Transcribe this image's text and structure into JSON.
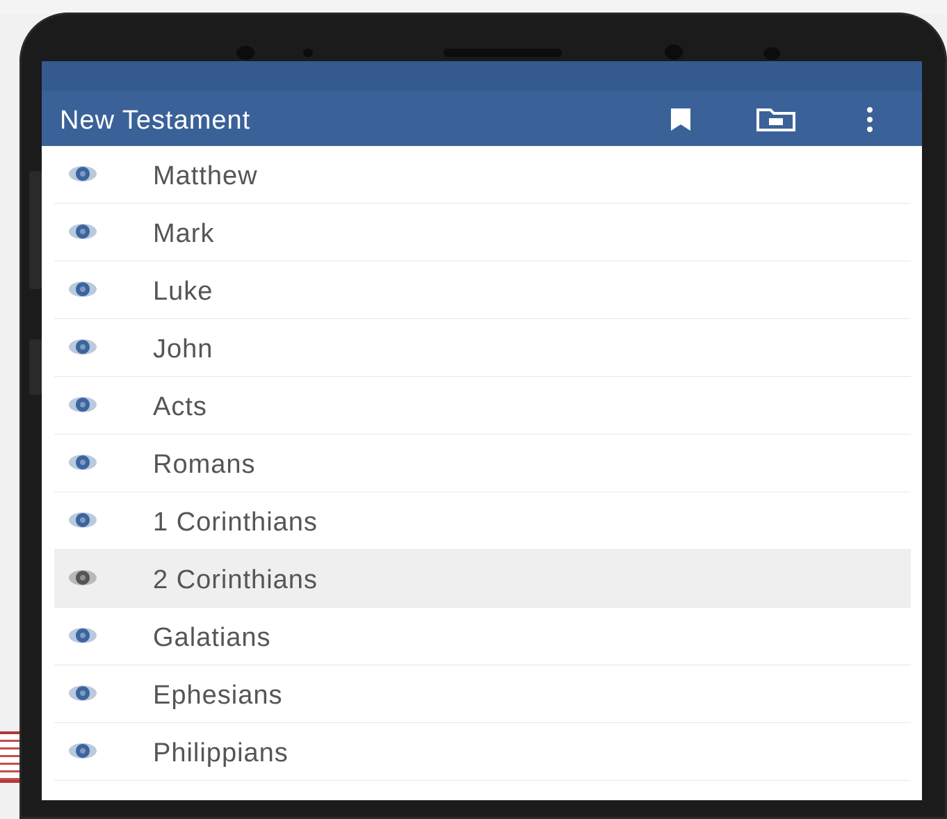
{
  "app_bar": {
    "title": "New Testament",
    "icons": [
      "bookmark-icon",
      "folder-icon",
      "more-vert-icon"
    ]
  },
  "colors": {
    "primary": "#3a6299",
    "status_bar": "#345a8f",
    "item_icon": "#3b659e",
    "item_icon_selected": "#555555",
    "selected_row": "#efefef",
    "text": "#555555"
  },
  "books": [
    {
      "label": "Matthew",
      "selected": false
    },
    {
      "label": "Mark",
      "selected": false
    },
    {
      "label": "Luke",
      "selected": false
    },
    {
      "label": "John",
      "selected": false
    },
    {
      "label": "Acts",
      "selected": false
    },
    {
      "label": "Romans",
      "selected": false
    },
    {
      "label": "1 Corinthians",
      "selected": false
    },
    {
      "label": "2 Corinthians",
      "selected": true
    },
    {
      "label": "Galatians",
      "selected": false
    },
    {
      "label": "Ephesians",
      "selected": false
    },
    {
      "label": "Philippians",
      "selected": false
    }
  ]
}
